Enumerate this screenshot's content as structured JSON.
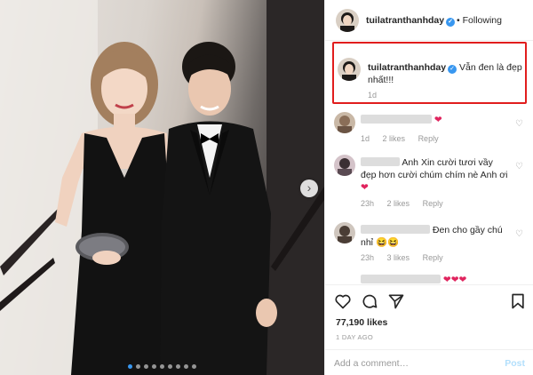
{
  "header": {
    "username": "tuilatranthanhday",
    "separator": "•",
    "follow_status": "Following"
  },
  "caption": {
    "username": "tuilatranthanhday",
    "text": "Vẫn đen là đẹp nhất!!!",
    "time": "1d"
  },
  "comments": [
    {
      "text": "",
      "emoji": "❤",
      "time": "1d",
      "likes": "2 likes",
      "reply": "Reply"
    },
    {
      "text": "Anh Xin cười tươi vầy đẹp hơn cười chúm chím nè Anh ơi",
      "emoji": "❤",
      "time": "23h",
      "likes": "2 likes",
      "reply": "Reply"
    },
    {
      "text": "Đen cho gầy chú nhỉ",
      "emoji": "😆😆",
      "time": "23h",
      "likes": "3 likes",
      "reply": "Reply"
    },
    {
      "emoji": "❤❤❤"
    }
  ],
  "actions": {
    "likes": "77,190 likes",
    "date": "1 DAY AGO"
  },
  "comment_input": {
    "placeholder": "Add a comment…",
    "post_label": "Post"
  },
  "carousel": {
    "next_icon": "chevron-right-icon",
    "dot_count": 9,
    "active_dot": 1
  },
  "colors": {
    "verified": "#3897f0",
    "highlight_border": "#e11d1d",
    "heart": "#e0245e",
    "post_disabled": "#b2dffc"
  }
}
